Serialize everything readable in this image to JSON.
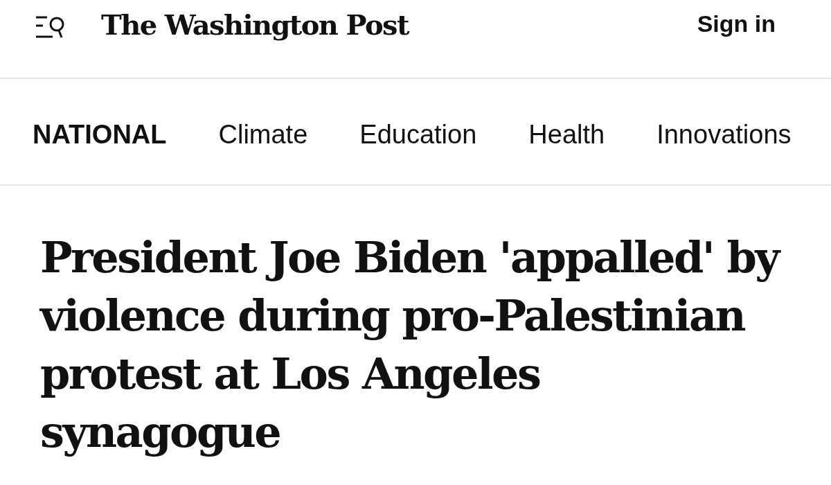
{
  "header": {
    "logo": "The Washington Post",
    "sign_in": "Sign in"
  },
  "nav": {
    "section": "NATIONAL",
    "links": [
      "Climate",
      "Education",
      "Health",
      "Innovations"
    ]
  },
  "article": {
    "headline": "President Joe Biden 'appalled' by violence during pro-Palestinian protest at Los Angeles synagogue"
  }
}
